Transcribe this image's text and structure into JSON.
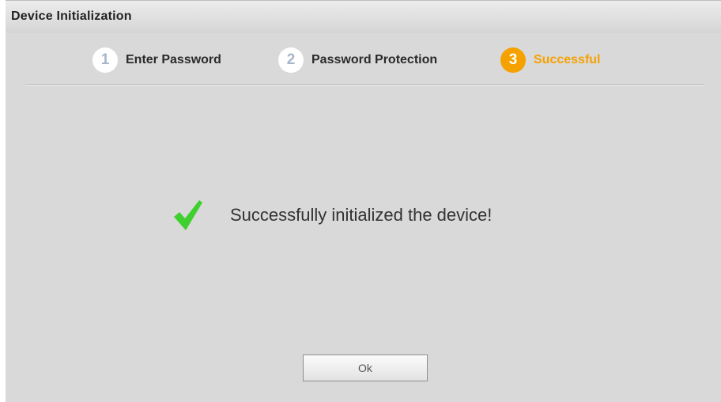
{
  "dialog": {
    "title": "Device Initialization"
  },
  "steps": [
    {
      "number": "1",
      "label": "Enter Password",
      "state": "completed"
    },
    {
      "number": "2",
      "label": "Password Protection",
      "state": "completed"
    },
    {
      "number": "3",
      "label": "Successful",
      "state": "active"
    }
  ],
  "result": {
    "icon": "checkmark-icon",
    "message": "Successfully initialized the device!"
  },
  "actions": {
    "ok_label": "Ok"
  },
  "colors": {
    "accent": "#f5a100",
    "success": "#3fcf2e",
    "background": "#d9d9d9"
  }
}
